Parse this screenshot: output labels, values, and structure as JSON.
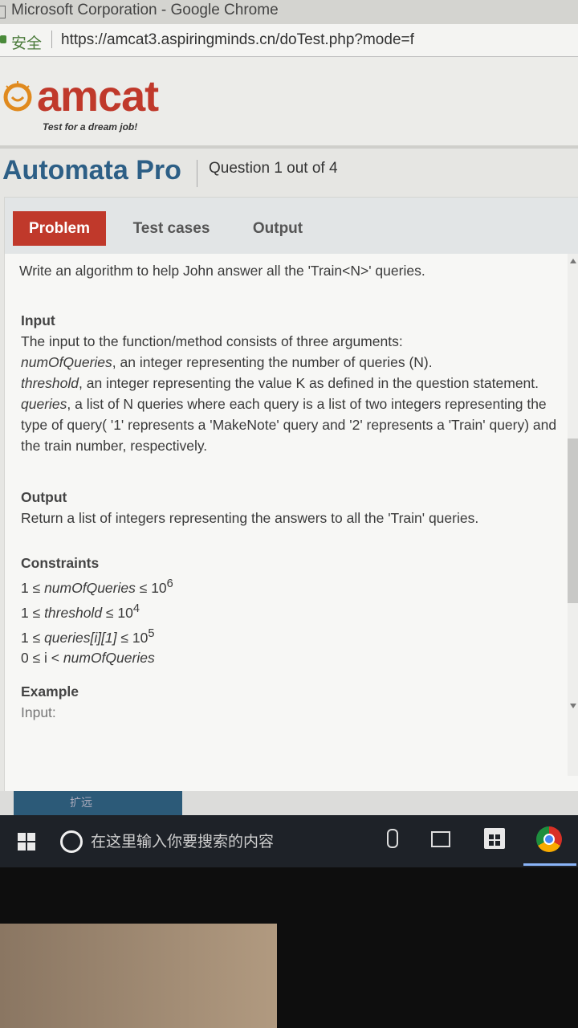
{
  "window": {
    "title": "Microsoft Corporation - Google Chrome"
  },
  "browser": {
    "secure_label": "安全",
    "url": "https://amcat3.aspiringminds.cn/doTest.php?mode=f"
  },
  "logo": {
    "name": "amcat",
    "tagline": "Test for a dream job!"
  },
  "header": {
    "test_title": "Automata Pro",
    "question_counter": "Question 1 out of 4"
  },
  "tabs": [
    {
      "label": "Problem",
      "active": true
    },
    {
      "label": "Test cases",
      "active": false
    },
    {
      "label": "Output",
      "active": false
    }
  ],
  "problem": {
    "intro": "Write an algorithm to help John answer all the 'Train<N>' queries.",
    "input": {
      "title": "Input",
      "lead": "The input to the function/method consists of three arguments:",
      "arg1_name": "numOfQueries",
      "arg1_desc": ", an integer representing the number of queries (N).",
      "arg2_name": "threshold",
      "arg2_desc": ", an integer representing the value K as defined in the question statement.",
      "arg3_name": "queries",
      "arg3_desc": ", a list of N queries where each query is a list of two integers representing the type of query( '1' represents a 'MakeNote' query and '2' represents a 'Train' query) and the train number, respectively."
    },
    "output": {
      "title": "Output",
      "text": "Return a list of integers representing the answers to all the 'Train' queries."
    },
    "constraints": {
      "title": "Constraints",
      "c1_pre": "1 ≤ ",
      "c1_var": "numOfQueries",
      "c1_post": " ≤ 10",
      "c1_exp": "6",
      "c2_pre": "1 ≤ ",
      "c2_var": "threshold",
      "c2_post": " ≤ 10",
      "c2_exp": "4",
      "c3_pre": "1 ≤ ",
      "c3_var": "queries[i][1]",
      "c3_post": " ≤ 10",
      "c3_exp": "5",
      "c4_pre": "0 ≤ i < ",
      "c4_var": "numOfQueries"
    },
    "example": {
      "title": "Example",
      "input_label": "Input:"
    }
  },
  "taskbar": {
    "search_placeholder": "在这里输入你要搜索的内容",
    "bottom_thumb_text": "扩远"
  }
}
